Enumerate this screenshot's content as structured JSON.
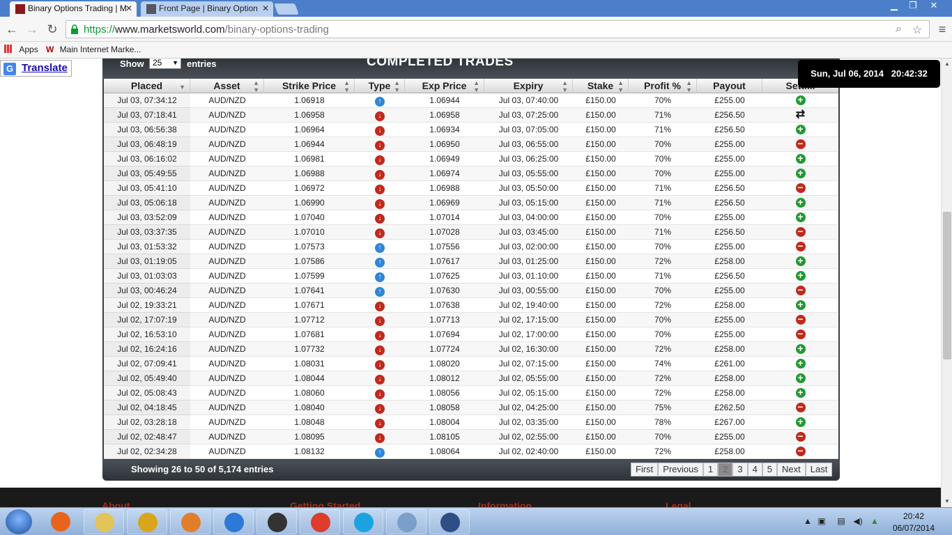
{
  "browser": {
    "tabs": [
      {
        "title": "Binary Options Trading | M"
      },
      {
        "title": "Front Page | Binary Option"
      }
    ],
    "url_scheme": "https://",
    "url_host": "www.marketsworld.com",
    "url_path": "/binary-options-trading",
    "bookmarks": [
      {
        "label": "Apps",
        "icon": "apps-grid-icon"
      },
      {
        "label": "Main Internet Marke...",
        "icon": "bookmark-favicon"
      }
    ]
  },
  "translate": {
    "label": "Translate"
  },
  "table": {
    "title": "COMPLETED TRADES",
    "show_label": "Show",
    "page_size": "25",
    "entries_label": "entries",
    "clock": "Sun, Jul 06, 2014   20:42:32",
    "columns": [
      "Placed",
      "Asset",
      "Strike Price",
      "Type",
      "Exp Price",
      "Expiry",
      "Stake",
      "Profit %",
      "Payout",
      "Settl..."
    ],
    "rows": [
      {
        "placed": "Jul 03, 07:34:12",
        "asset": "AUD/NZD",
        "strike": "1.06918",
        "type": "up",
        "exp": "1.06944",
        "expiry": "Jul 03, 07:40:00",
        "stake": "£150.00",
        "profit": "70%",
        "payout": "£255.00",
        "result": "win"
      },
      {
        "placed": "Jul 03, 07:18:41",
        "asset": "AUD/NZD",
        "strike": "1.06958",
        "type": "down",
        "exp": "1.06958",
        "expiry": "Jul 03, 07:25:00",
        "stake": "£150.00",
        "profit": "71%",
        "payout": "£256.50",
        "result": "draw"
      },
      {
        "placed": "Jul 03, 06:56:38",
        "asset": "AUD/NZD",
        "strike": "1.06964",
        "type": "down",
        "exp": "1.06934",
        "expiry": "Jul 03, 07:05:00",
        "stake": "£150.00",
        "profit": "71%",
        "payout": "£256.50",
        "result": "win"
      },
      {
        "placed": "Jul 03, 06:48:19",
        "asset": "AUD/NZD",
        "strike": "1.06944",
        "type": "down",
        "exp": "1.06950",
        "expiry": "Jul 03, 06:55:00",
        "stake": "£150.00",
        "profit": "70%",
        "payout": "£255.00",
        "result": "loss"
      },
      {
        "placed": "Jul 03, 06:16:02",
        "asset": "AUD/NZD",
        "strike": "1.06981",
        "type": "down",
        "exp": "1.06949",
        "expiry": "Jul 03, 06:25:00",
        "stake": "£150.00",
        "profit": "70%",
        "payout": "£255.00",
        "result": "win"
      },
      {
        "placed": "Jul 03, 05:49:55",
        "asset": "AUD/NZD",
        "strike": "1.06988",
        "type": "down",
        "exp": "1.06974",
        "expiry": "Jul 03, 05:55:00",
        "stake": "£150.00",
        "profit": "70%",
        "payout": "£255.00",
        "result": "win"
      },
      {
        "placed": "Jul 03, 05:41:10",
        "asset": "AUD/NZD",
        "strike": "1.06972",
        "type": "down",
        "exp": "1.06988",
        "expiry": "Jul 03, 05:50:00",
        "stake": "£150.00",
        "profit": "71%",
        "payout": "£256.50",
        "result": "loss"
      },
      {
        "placed": "Jul 03, 05:06:18",
        "asset": "AUD/NZD",
        "strike": "1.06990",
        "type": "down",
        "exp": "1.06969",
        "expiry": "Jul 03, 05:15:00",
        "stake": "£150.00",
        "profit": "71%",
        "payout": "£256.50",
        "result": "win"
      },
      {
        "placed": "Jul 03, 03:52:09",
        "asset": "AUD/NZD",
        "strike": "1.07040",
        "type": "down",
        "exp": "1.07014",
        "expiry": "Jul 03, 04:00:00",
        "stake": "£150.00",
        "profit": "70%",
        "payout": "£255.00",
        "result": "win"
      },
      {
        "placed": "Jul 03, 03:37:35",
        "asset": "AUD/NZD",
        "strike": "1.07010",
        "type": "down",
        "exp": "1.07028",
        "expiry": "Jul 03, 03:45:00",
        "stake": "£150.00",
        "profit": "71%",
        "payout": "£256.50",
        "result": "loss"
      },
      {
        "placed": "Jul 03, 01:53:32",
        "asset": "AUD/NZD",
        "strike": "1.07573",
        "type": "up",
        "exp": "1.07556",
        "expiry": "Jul 03, 02:00:00",
        "stake": "£150.00",
        "profit": "70%",
        "payout": "£255.00",
        "result": "loss"
      },
      {
        "placed": "Jul 03, 01:19:05",
        "asset": "AUD/NZD",
        "strike": "1.07586",
        "type": "up",
        "exp": "1.07617",
        "expiry": "Jul 03, 01:25:00",
        "stake": "£150.00",
        "profit": "72%",
        "payout": "£258.00",
        "result": "win"
      },
      {
        "placed": "Jul 03, 01:03:03",
        "asset": "AUD/NZD",
        "strike": "1.07599",
        "type": "up",
        "exp": "1.07625",
        "expiry": "Jul 03, 01:10:00",
        "stake": "£150.00",
        "profit": "71%",
        "payout": "£256.50",
        "result": "win"
      },
      {
        "placed": "Jul 03, 00:46:24",
        "asset": "AUD/NZD",
        "strike": "1.07641",
        "type": "up",
        "exp": "1.07630",
        "expiry": "Jul 03, 00:55:00",
        "stake": "£150.00",
        "profit": "70%",
        "payout": "£255.00",
        "result": "loss"
      },
      {
        "placed": "Jul 02, 19:33:21",
        "asset": "AUD/NZD",
        "strike": "1.07671",
        "type": "down",
        "exp": "1.07638",
        "expiry": "Jul 02, 19:40:00",
        "stake": "£150.00",
        "profit": "72%",
        "payout": "£258.00",
        "result": "win"
      },
      {
        "placed": "Jul 02, 17:07:19",
        "asset": "AUD/NZD",
        "strike": "1.07712",
        "type": "down",
        "exp": "1.07713",
        "expiry": "Jul 02, 17:15:00",
        "stake": "£150.00",
        "profit": "70%",
        "payout": "£255.00",
        "result": "loss"
      },
      {
        "placed": "Jul 02, 16:53:10",
        "asset": "AUD/NZD",
        "strike": "1.07681",
        "type": "down",
        "exp": "1.07694",
        "expiry": "Jul 02, 17:00:00",
        "stake": "£150.00",
        "profit": "70%",
        "payout": "£255.00",
        "result": "loss"
      },
      {
        "placed": "Jul 02, 16:24:16",
        "asset": "AUD/NZD",
        "strike": "1.07732",
        "type": "down",
        "exp": "1.07724",
        "expiry": "Jul 02, 16:30:00",
        "stake": "£150.00",
        "profit": "72%",
        "payout": "£258.00",
        "result": "win"
      },
      {
        "placed": "Jul 02, 07:09:41",
        "asset": "AUD/NZD",
        "strike": "1.08031",
        "type": "down",
        "exp": "1.08020",
        "expiry": "Jul 02, 07:15:00",
        "stake": "£150.00",
        "profit": "74%",
        "payout": "£261.00",
        "result": "win"
      },
      {
        "placed": "Jul 02, 05:49:40",
        "asset": "AUD/NZD",
        "strike": "1.08044",
        "type": "down",
        "exp": "1.08012",
        "expiry": "Jul 02, 05:55:00",
        "stake": "£150.00",
        "profit": "72%",
        "payout": "£258.00",
        "result": "win"
      },
      {
        "placed": "Jul 02, 05:08:43",
        "asset": "AUD/NZD",
        "strike": "1.08060",
        "type": "down",
        "exp": "1.08056",
        "expiry": "Jul 02, 05:15:00",
        "stake": "£150.00",
        "profit": "72%",
        "payout": "£258.00",
        "result": "win"
      },
      {
        "placed": "Jul 02, 04:18:45",
        "asset": "AUD/NZD",
        "strike": "1.08040",
        "type": "down",
        "exp": "1.08058",
        "expiry": "Jul 02, 04:25:00",
        "stake": "£150.00",
        "profit": "75%",
        "payout": "£262.50",
        "result": "loss"
      },
      {
        "placed": "Jul 02, 03:28:18",
        "asset": "AUD/NZD",
        "strike": "1.08048",
        "type": "down",
        "exp": "1.08004",
        "expiry": "Jul 02, 03:35:00",
        "stake": "£150.00",
        "profit": "78%",
        "payout": "£267.00",
        "result": "win"
      },
      {
        "placed": "Jul 02, 02:48:47",
        "asset": "AUD/NZD",
        "strike": "1.08095",
        "type": "down",
        "exp": "1.08105",
        "expiry": "Jul 02, 02:55:00",
        "stake": "£150.00",
        "profit": "70%",
        "payout": "£255.00",
        "result": "loss"
      },
      {
        "placed": "Jul 02, 02:34:28",
        "asset": "AUD/NZD",
        "strike": "1.08132",
        "type": "up",
        "exp": "1.08064",
        "expiry": "Jul 02, 02:40:00",
        "stake": "£150.00",
        "profit": "72%",
        "payout": "£258.00",
        "result": "loss"
      }
    ],
    "footer_info": "Showing 26 to 50 of 5,174 entries",
    "pager": [
      "First",
      "Previous",
      "1",
      "2",
      "3",
      "4",
      "5",
      "Next",
      "Last"
    ],
    "current_page": "2"
  },
  "site_footer": {
    "headings": [
      "About",
      "Getting Started",
      "Information",
      "Legal"
    ]
  },
  "taskbar": {
    "time": "20:42",
    "date": "06/07/2014",
    "apps": [
      "firefox-icon",
      "file-explorer-icon",
      "tools-icon",
      "media-player-icon",
      "notepad-icon",
      "camera-icon",
      "chrome-icon",
      "skype-icon",
      "network-icon",
      "video-icon"
    ]
  },
  "colors": {
    "win": "#1f9a31",
    "loss": "#c0291c",
    "up": "#2f86d6",
    "down": "#c0291c",
    "titlebar": "#4c7fc9"
  }
}
